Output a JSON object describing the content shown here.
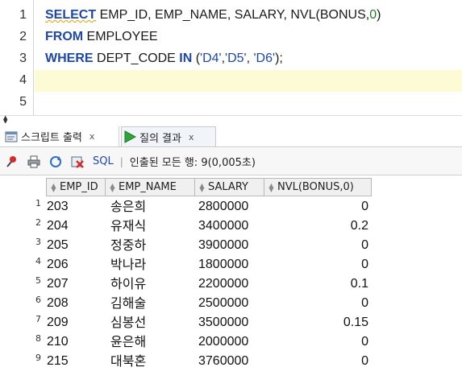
{
  "editor": {
    "line_numbers": [
      "1",
      "2",
      "3",
      "4",
      "5"
    ],
    "line1": {
      "kw": "SELECT",
      "rest": " EMP_ID, EMP_NAME, SALARY, NVL(BONUS,",
      "num": "0",
      "close": ")"
    },
    "line2": {
      "kw": "FROM",
      "rest": " EMPLOYEE"
    },
    "line3": {
      "kw1": "WHERE",
      "mid": " DEPT_CODE ",
      "kw2": "IN",
      "open": " (",
      "s1": "'D4'",
      "c1": ",",
      "s2": "'D5'",
      "c2": ", ",
      "s3": "'D6'",
      "close": ");"
    }
  },
  "tabs": {
    "script_label": "스크립트 출력",
    "script_close": "x",
    "result_label": "질의 결과",
    "result_close": "x"
  },
  "toolbar": {
    "sql_label": "SQL",
    "separator": "|",
    "status": "인출된 모든 행: 9(0,005초)"
  },
  "grid": {
    "columns": [
      "EMP_ID",
      "EMP_NAME",
      "SALARY",
      "NVL(BONUS,0)"
    ],
    "rows": [
      {
        "n": "1",
        "id": "203",
        "name": "송은희",
        "salary": "2800000",
        "nvl": "0"
      },
      {
        "n": "2",
        "id": "204",
        "name": "유재식",
        "salary": "3400000",
        "nvl": "0.2"
      },
      {
        "n": "3",
        "id": "205",
        "name": "정중하",
        "salary": "3900000",
        "nvl": "0"
      },
      {
        "n": "4",
        "id": "206",
        "name": "박나라",
        "salary": "1800000",
        "nvl": "0"
      },
      {
        "n": "5",
        "id": "207",
        "name": "하이유",
        "salary": "2200000",
        "nvl": "0.1"
      },
      {
        "n": "6",
        "id": "208",
        "name": "김해술",
        "salary": "2500000",
        "nvl": "0"
      },
      {
        "n": "7",
        "id": "209",
        "name": "심봉선",
        "salary": "3500000",
        "nvl": "0.15"
      },
      {
        "n": "8",
        "id": "210",
        "name": "윤은해",
        "salary": "2000000",
        "nvl": "0"
      },
      {
        "n": "9",
        "id": "215",
        "name": "대북혼",
        "salary": "3760000",
        "nvl": "0"
      }
    ]
  },
  "colors": {
    "keyword": "#1e47a8",
    "current_line": "#fdfbd6",
    "number_literal": "#2a7a2a"
  }
}
